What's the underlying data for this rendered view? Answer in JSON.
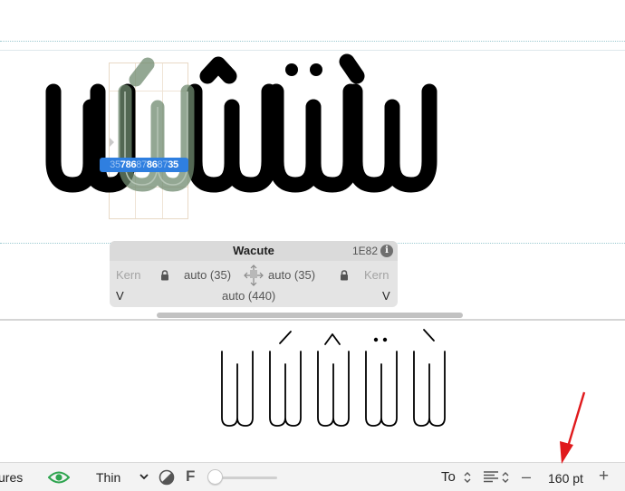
{
  "edit_view": {
    "glyphs_label": "wẃŵẅẁ",
    "kern_values": [
      "35",
      "7",
      "86",
      "87",
      "86",
      "87",
      "35"
    ]
  },
  "info_panel": {
    "glyph_name": "Wacute",
    "unicode": "1E82",
    "info_icon_glyph": "i",
    "left_kern_label": "Kern",
    "right_kern_label": "Kern",
    "lsb": "auto (35)",
    "rsb": "auto (35)",
    "left_glyph": "V",
    "right_glyph": "V",
    "width": "auto (440)"
  },
  "toolbar": {
    "features_label": "ures",
    "weight_label": "Thin",
    "f_label": "F",
    "to_label": "To",
    "size_label": "160 pt",
    "minus_label": "–",
    "plus_label": "+"
  },
  "colors": {
    "selection": "#2f7fe0",
    "eye_icon": "#2ea44f",
    "arrow": "#e0191c"
  },
  "icons": [
    "eye-icon",
    "lock-icon",
    "link-metrics-icon",
    "info-icon",
    "contrast-icon",
    "align-icon",
    "chevron-down-icon",
    "up-down-icon"
  ]
}
